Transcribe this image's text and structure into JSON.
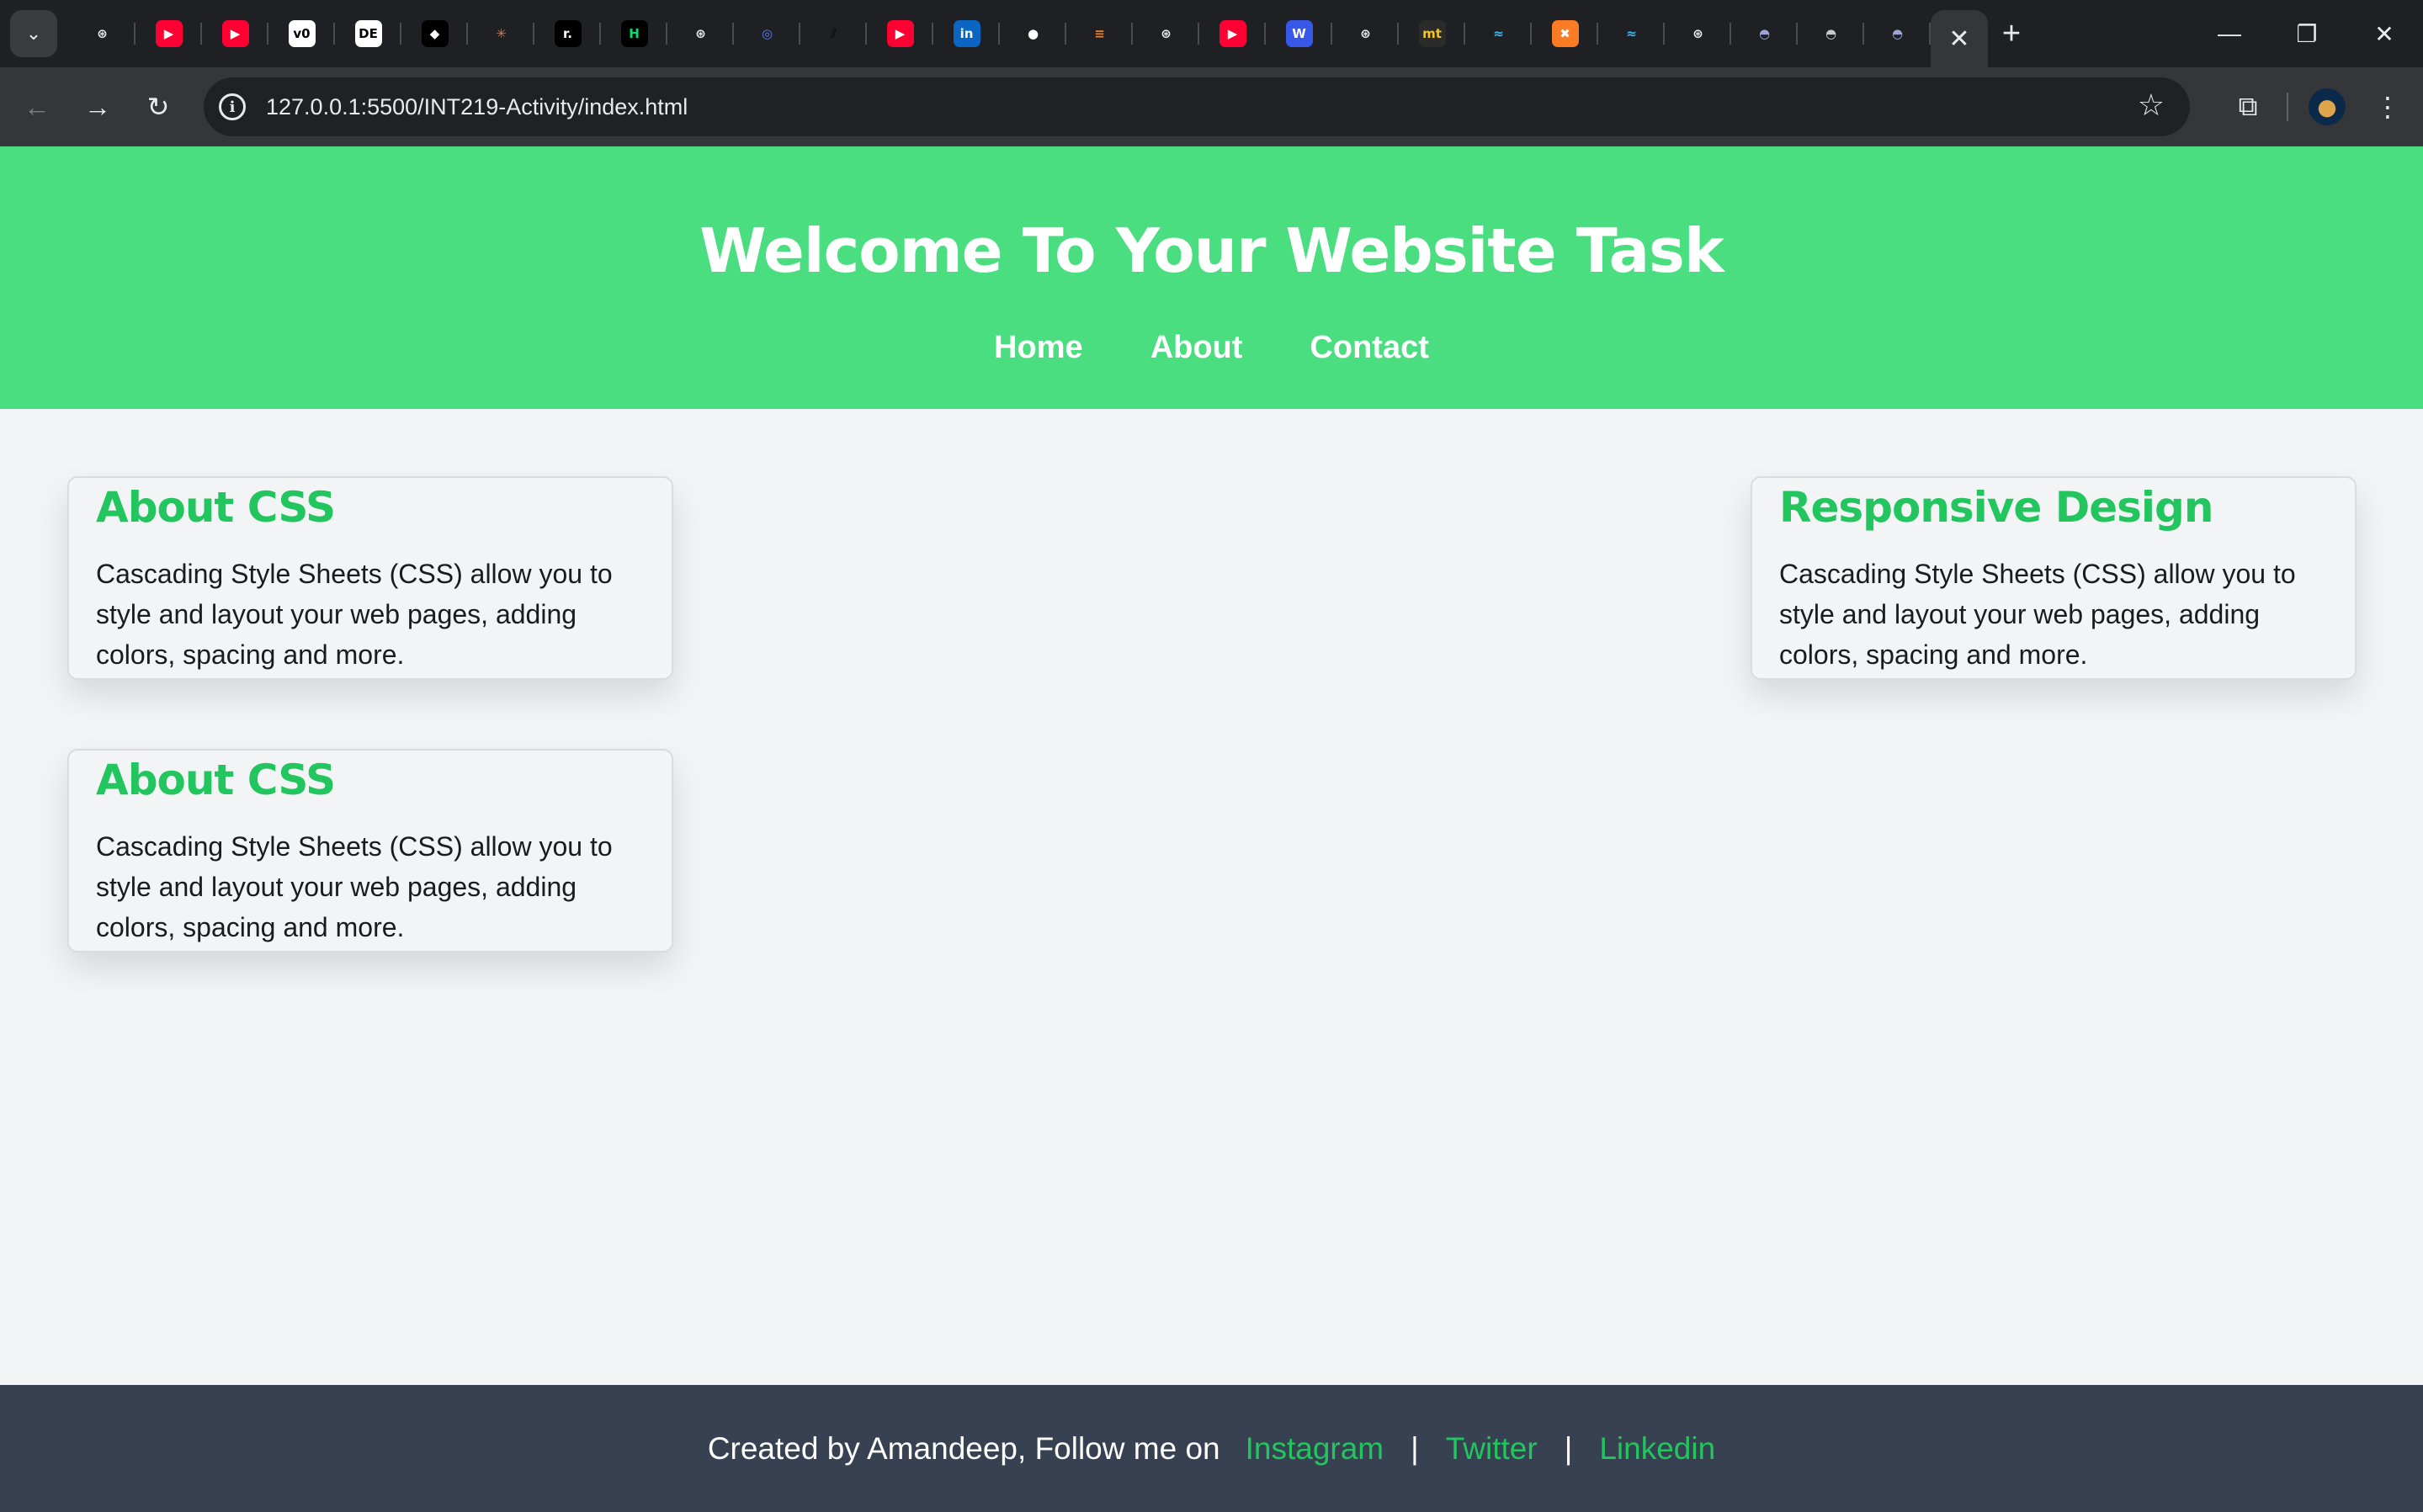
{
  "browser": {
    "tabs": [
      {
        "icon": "chatgpt-icon",
        "glyph": "⊛",
        "bg": "#1f2023",
        "fg": "#e8eaed"
      },
      {
        "icon": "youtube-icon",
        "glyph": "▶",
        "bg": "#ff0033",
        "fg": "#ffffff"
      },
      {
        "icon": "youtube-icon",
        "glyph": "▶",
        "bg": "#ff0033",
        "fg": "#ffffff"
      },
      {
        "icon": "v0-icon",
        "glyph": "v0",
        "bg": "#ffffff",
        "fg": "#000000"
      },
      {
        "icon": "de-icon",
        "glyph": "DE",
        "bg": "#ffffff",
        "fg": "#000000"
      },
      {
        "icon": "cube-icon",
        "glyph": "◆",
        "bg": "#000000",
        "fg": "#ffffff"
      },
      {
        "icon": "claude-icon",
        "glyph": "✳",
        "bg": "#1f2023",
        "fg": "#d97757"
      },
      {
        "icon": "replit-r-icon",
        "glyph": "r.",
        "bg": "#000000",
        "fg": "#ffffff"
      },
      {
        "icon": "hashnode-icon",
        "glyph": "H",
        "bg": "#000000",
        "fg": "#00e070"
      },
      {
        "icon": "chatgpt-icon",
        "glyph": "⊛",
        "bg": "#1f2023",
        "fg": "#e8eaed"
      },
      {
        "icon": "deepseek-icon",
        "glyph": "◎",
        "bg": "#1f2023",
        "fg": "#5b7cf7"
      },
      {
        "icon": "slash-icon",
        "glyph": "⫽",
        "bg": "#1f2023",
        "fg": "#111111"
      },
      {
        "icon": "youtube-icon",
        "glyph": "▶",
        "bg": "#ff0033",
        "fg": "#ffffff"
      },
      {
        "icon": "linkedin-icon",
        "glyph": "in",
        "bg": "#0a66c2",
        "fg": "#ffffff"
      },
      {
        "icon": "github-icon",
        "glyph": "●",
        "bg": "#1f2023",
        "fg": "#ffffff"
      },
      {
        "icon": "stackoverflow-icon",
        "glyph": "≡",
        "bg": "#1f2023",
        "fg": "#f48024"
      },
      {
        "icon": "chatgpt-icon",
        "glyph": "⊛",
        "bg": "#1f2023",
        "fg": "#e8eaed"
      },
      {
        "icon": "youtube-icon",
        "glyph": "▶",
        "bg": "#ff0033",
        "fg": "#ffffff"
      },
      {
        "icon": "wordpress-icon",
        "glyph": "W",
        "bg": "#3858e9",
        "fg": "#ffffff"
      },
      {
        "icon": "chatgpt-icon",
        "glyph": "⊛",
        "bg": "#1f2023",
        "fg": "#e8eaed"
      },
      {
        "icon": "mt-icon",
        "glyph": "mt",
        "bg": "#2b2b2b",
        "fg": "#f5c518"
      },
      {
        "icon": "tailwind-icon",
        "glyph": "≈",
        "bg": "#1f2023",
        "fg": "#38bdf8"
      },
      {
        "icon": "xampp-icon",
        "glyph": "✖",
        "bg": "#fb7a24",
        "fg": "#ffffff"
      },
      {
        "icon": "tailwind-icon",
        "glyph": "≈",
        "bg": "#1f2023",
        "fg": "#38bdf8"
      },
      {
        "icon": "chatgpt-icon",
        "glyph": "⊛",
        "bg": "#1f2023",
        "fg": "#e8eaed"
      },
      {
        "icon": "dome-icon",
        "glyph": "◓",
        "bg": "#1f2023",
        "fg": "#9aa6d6"
      },
      {
        "icon": "dome-icon",
        "glyph": "◓",
        "bg": "#1f2023",
        "fg": "#c9c9c9"
      },
      {
        "icon": "dome-icon",
        "glyph": "◓",
        "bg": "#1f2023",
        "fg": "#9aa6d6"
      }
    ],
    "active_tab_close": "✕",
    "new_tab": "+",
    "url": "127.0.0.1:5500/INT219-Activity/index.html"
  },
  "page": {
    "title": "Welcome To Your Website Task",
    "nav": [
      "Home",
      "About",
      "Contact"
    ],
    "cards": [
      {
        "heading": "About CSS",
        "text": "Cascading Style Sheets (CSS) allow you to style and layout your web pages, adding colors, spacing and more."
      },
      {
        "heading": "Responsive Design",
        "text": "Cascading Style Sheets (CSS) allow you to style and layout your web pages, adding colors, spacing and more."
      },
      {
        "heading": "About CSS",
        "text": "Cascading Style Sheets (CSS) allow you to style and layout your web pages, adding colors, spacing and more."
      }
    ],
    "footer": {
      "lead": "Created by Amandeep, Follow me on",
      "links": [
        "Instagram",
        "Twitter",
        "Linkedin"
      ],
      "separator": "|"
    }
  },
  "colors": {
    "header_bg": "#4ade80",
    "accent_green": "#22c55e",
    "footer_bg": "#374151",
    "page_bg": "#f3f4f6"
  }
}
